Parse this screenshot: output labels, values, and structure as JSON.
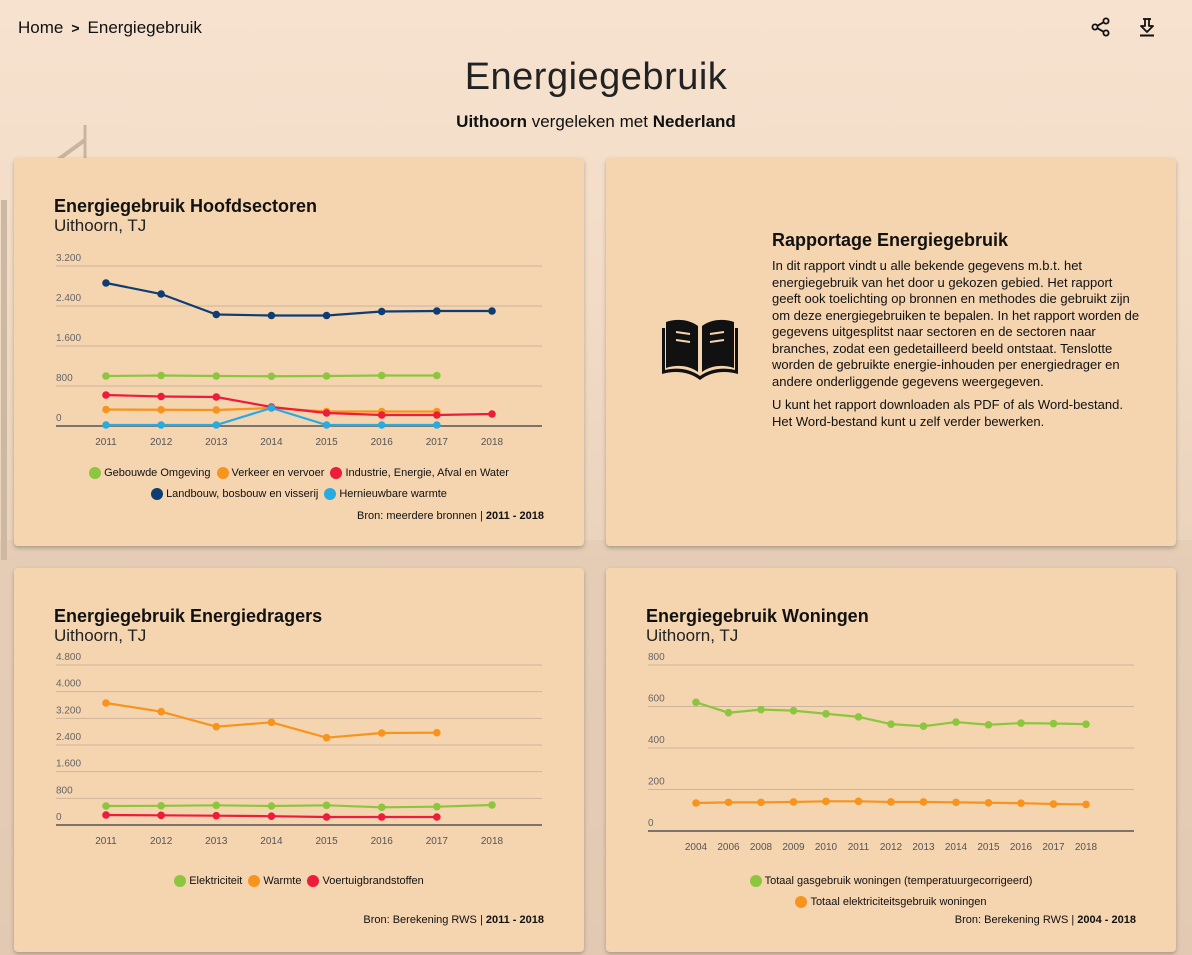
{
  "breadcrumb": {
    "home": "Home",
    "current": "Energiegebruik"
  },
  "header": {
    "title": "Energiegebruik",
    "subtitle_place": "Uithoorn",
    "subtitle_mid": " vergeleken met ",
    "subtitle_compare": "Nederland"
  },
  "icons": {
    "share": "share-icon",
    "download": "download-icon",
    "report": "book-open-icon"
  },
  "colors": {
    "card_bg": "#f5d4b0",
    "green": "#8cc63f",
    "orange": "#f7941d",
    "red": "#ed1c3a",
    "navy": "#0e3d73",
    "cyan": "#29abe2"
  },
  "cards": {
    "hoofdsectoren": {
      "title": "Energiegebruik Hoofdsectoren",
      "subtitle": "Uithoorn, TJ",
      "source_label": "Bron: meerdere bronnen | ",
      "source_range": "2011 - 2018"
    },
    "rapportage": {
      "title": "Rapportage Energiegebruik",
      "paragraph1": "In dit rapport vindt u alle bekende gegevens m.b.t. het energiegebruik van het door u gekozen gebied. Het rapport geeft ook toelichting op bronnen en methodes die gebruikt zijn om deze energiegebruiken te bepalen. In het rapport worden de gegevens uitgesplitst naar sectoren en de sectoren naar branches, zodat een gedetailleerd beeld ontstaat. Tenslotte worden de gebruikte energie-inhouden per energiedrager en andere onderliggende gegevens weergegeven.",
      "paragraph2": "U kunt het rapport downloaden als PDF of als Word-bestand. Het Word-bestand kunt u zelf verder bewerken."
    },
    "energiedragers": {
      "title": "Energiegebruik Energiedragers",
      "subtitle": "Uithoorn, TJ",
      "source_label": "Bron: Berekening RWS | ",
      "source_range": "2011 - 2018"
    },
    "woningen": {
      "title": "Energiegebruik Woningen",
      "subtitle": "Uithoorn, TJ",
      "source_label": "Bron: Berekening RWS | ",
      "source_range": "2004 - 2018"
    }
  },
  "chart_data": [
    {
      "id": "hoofdsectoren",
      "type": "line",
      "x": [
        "2011",
        "2012",
        "2013",
        "2014",
        "2015",
        "2016",
        "2017",
        "2018"
      ],
      "ylim": [
        0,
        3200
      ],
      "yticks": [
        0,
        800,
        1600,
        2400,
        3200
      ],
      "ytick_labels": [
        "0",
        "800",
        "1.600",
        "2.400",
        "3.200"
      ],
      "series": [
        {
          "name": "Gebouwde Omgeving",
          "color": "#8cc63f",
          "values": [
            1000,
            1010,
            1000,
            995,
            1000,
            1010,
            1010,
            null
          ]
        },
        {
          "name": "Verkeer en vervoer",
          "color": "#f7941d",
          "values": [
            330,
            325,
            320,
            360,
            290,
            290,
            290,
            null
          ]
        },
        {
          "name": "Industrie, Energie, Afval en Water",
          "color": "#ed1c3a",
          "values": [
            620,
            590,
            580,
            380,
            260,
            220,
            220,
            240
          ]
        },
        {
          "name": "Landbouw, bosbouw en visserij",
          "color": "#0e3d73",
          "values": [
            2860,
            2640,
            2230,
            2210,
            2210,
            2290,
            2300,
            2300
          ]
        },
        {
          "name": "Hernieuwbare warmte",
          "color": "#29abe2",
          "values": [
            20,
            20,
            20,
            360,
            20,
            20,
            20,
            null
          ]
        }
      ]
    },
    {
      "id": "energiedragers",
      "type": "line",
      "x": [
        "2011",
        "2012",
        "2013",
        "2014",
        "2015",
        "2016",
        "2017",
        "2018"
      ],
      "ylim": [
        0,
        4800
      ],
      "yticks": [
        0,
        800,
        1600,
        2400,
        3200,
        4000,
        4800
      ],
      "ytick_labels": [
        "0",
        "800",
        "1.600",
        "2.400",
        "3.200",
        "4.000",
        "4.800"
      ],
      "series": [
        {
          "name": "Elektriciteit",
          "color": "#8cc63f",
          "values": [
            570,
            575,
            590,
            570,
            590,
            530,
            550,
            600
          ]
        },
        {
          "name": "Warmte",
          "color": "#f7941d",
          "values": [
            3660,
            3400,
            2950,
            3080,
            2620,
            2760,
            2770,
            null
          ]
        },
        {
          "name": "Voertuigbrandstoffen",
          "color": "#ed1c3a",
          "values": [
            300,
            290,
            280,
            265,
            240,
            240,
            240,
            null
          ]
        }
      ]
    },
    {
      "id": "woningen",
      "type": "line",
      "x": [
        "2004",
        "2006",
        "2008",
        "2009",
        "2010",
        "2011",
        "2012",
        "2013",
        "2014",
        "2015",
        "2016",
        "2017",
        "2018"
      ],
      "ylim": [
        0,
        800
      ],
      "yticks": [
        0,
        200,
        400,
        600,
        800
      ],
      "ytick_labels": [
        "0",
        "200",
        "400",
        "600",
        "800"
      ],
      "series": [
        {
          "name": "Totaal gasgebruik woningen (temperatuurgecorrigeerd)",
          "color": "#8cc63f",
          "values": [
            620,
            570,
            585,
            580,
            565,
            550,
            515,
            505,
            525,
            512,
            520,
            518,
            515
          ]
        },
        {
          "name": "Totaal elektriciteitsgebruik woningen",
          "color": "#f7941d",
          "values": [
            135,
            138,
            138,
            140,
            143,
            143,
            140,
            140,
            138,
            136,
            134,
            130,
            128
          ]
        }
      ]
    }
  ]
}
